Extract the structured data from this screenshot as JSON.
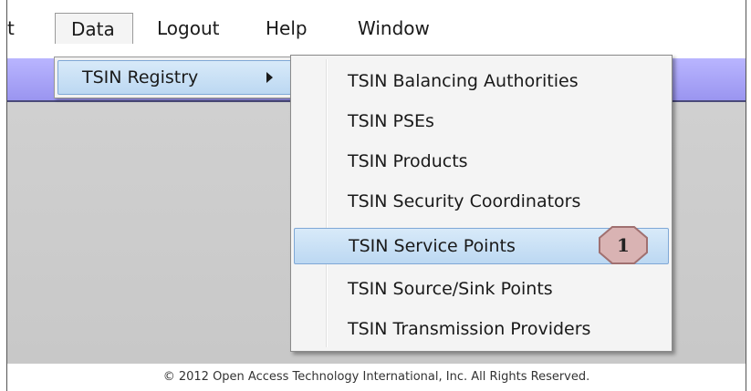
{
  "menubar": {
    "items": [
      "t",
      "Data",
      "Logout",
      "Help",
      "Window"
    ]
  },
  "submenu": {
    "label": "TSIN Registry"
  },
  "dropdown": {
    "items": [
      "TSIN Balancing Authorities",
      "TSIN PSEs",
      "TSIN Products",
      "TSIN Security Coordinators",
      "TSIN Service Points",
      "TSIN Source/Sink Points",
      "TSIN Transmission Providers"
    ],
    "highlighted_item": "TSIN Service Points"
  },
  "callout": {
    "number": "1",
    "fill": "#d9b3b3",
    "stroke": "#a07070"
  },
  "footer": {
    "text": "© 2012 Open Access Technology International, Inc. All Rights Reserved."
  },
  "colors": {
    "band": "#a8a4f6",
    "highlight": "#c8e0f6",
    "highlight_border": "#7fa8d6"
  }
}
